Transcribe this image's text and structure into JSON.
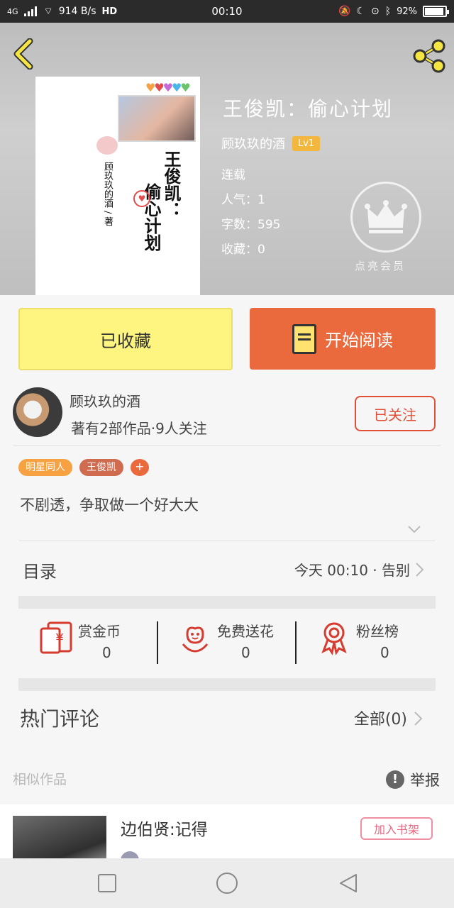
{
  "status_bar": {
    "network": "4G",
    "speed": "914 B/s",
    "hd": "HD",
    "time": "00:10",
    "battery": "92%",
    "battery_level": 0.92
  },
  "book": {
    "title": "王俊凯：偷心计划",
    "author": "顾玖玖的酒",
    "level": "Lv1",
    "stats": [
      "连载",
      "人气：1",
      "字数：595",
      "收藏：0"
    ],
    "vip_label": "点亮会员"
  },
  "cover": {
    "title_line1": "王俊凯：",
    "title_line2": "偷心计划",
    "byline": "顾玖玖的酒 / 著"
  },
  "actions": {
    "collected_label": "已收藏",
    "read_label": "开始阅读"
  },
  "author_info": {
    "name": "顾玖玖的酒",
    "works_fans": "著有2部作品·9人关注",
    "follow_label": "已关注"
  },
  "tags": [
    "明星同人",
    "王俊凯"
  ],
  "tag_add": "+",
  "description": "不剧透，争取做一个好大大",
  "catalog": {
    "label": "目录",
    "latest": "今天 00:10 · 告别"
  },
  "rewards": [
    {
      "label": "赏金币",
      "count": "0",
      "icon": "red-envelope-icon"
    },
    {
      "label": "免费送花",
      "count": "0",
      "icon": "flower-icon"
    },
    {
      "label": "粉丝榜",
      "count": "0",
      "icon": "ribbon-badge-icon"
    }
  ],
  "hot_comments": {
    "label": "热门评论",
    "all_label": "全部(0)"
  },
  "similar": {
    "section_label": "相似作品",
    "report_label": "举报",
    "items": [
      {
        "title": "边伯贤:记得",
        "add_label": "加入书架"
      }
    ]
  },
  "colors": {
    "accent_orange": "#ea6a3e",
    "collected_yellow": "#fdf57f",
    "tag_orange": "#f6a142",
    "tag_rust": "#cf6b4e",
    "back_icon_yellow": "#f5e542"
  }
}
